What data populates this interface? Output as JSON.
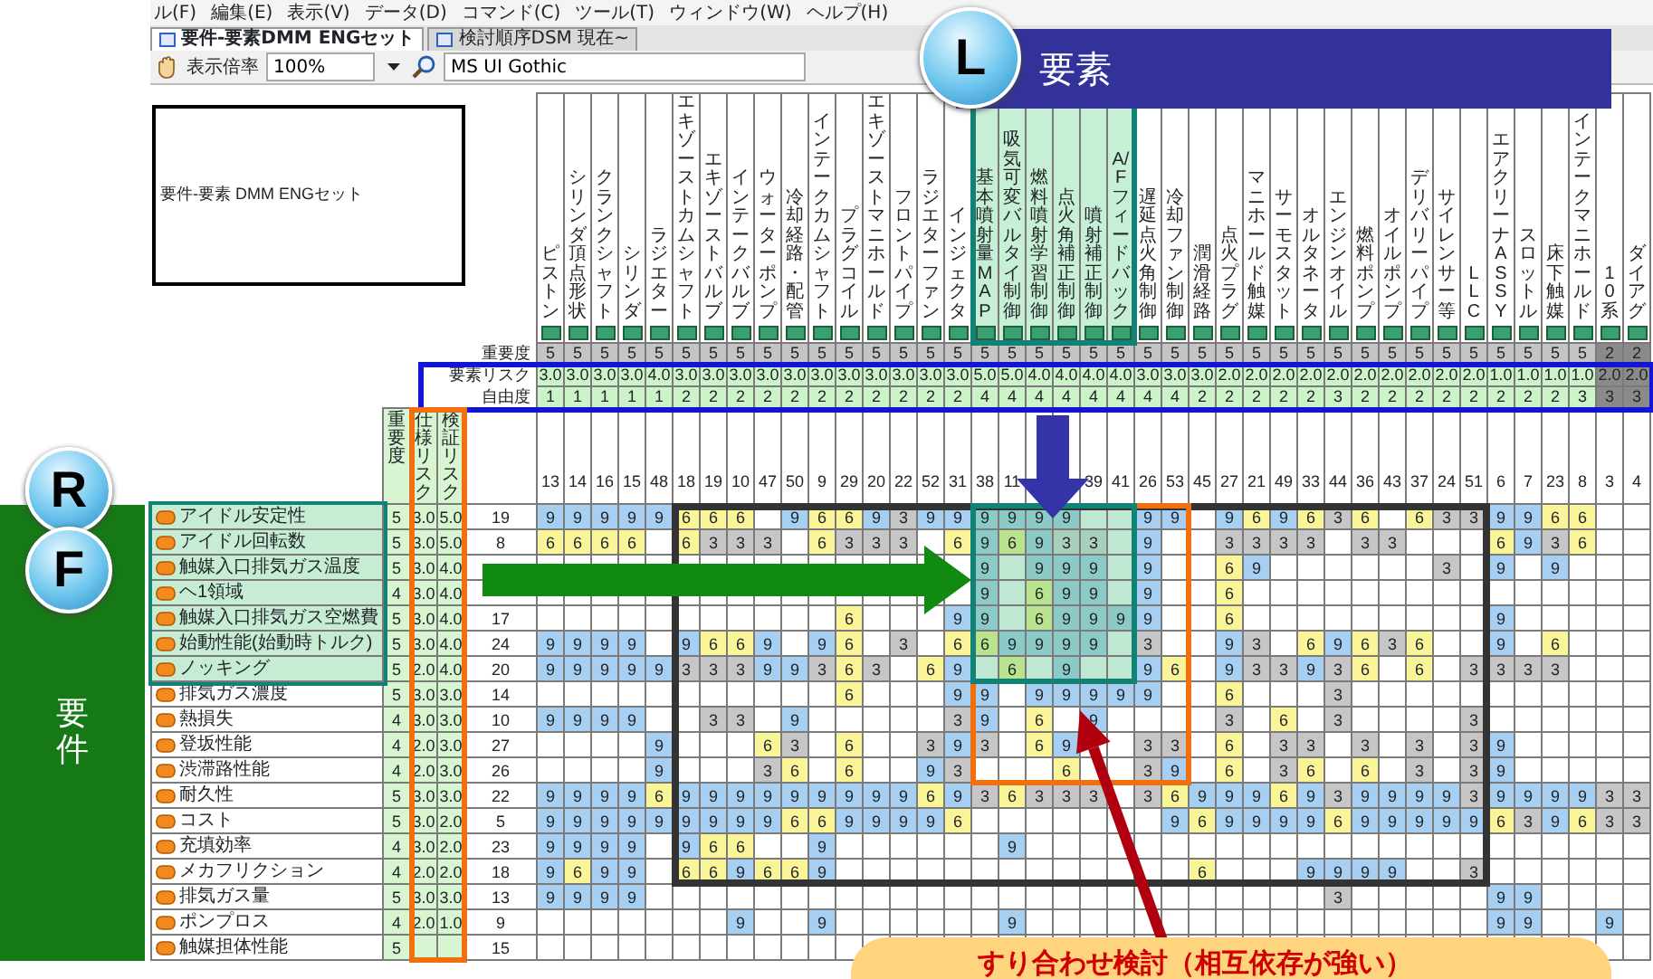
{
  "menu_bar": [
    "ル(F)",
    "編集(E)",
    "表示(V)",
    "データ(D)",
    "コマンド(C)",
    "ツール(T)",
    "ウィンドウ(W)",
    "ヘルプ(H)"
  ],
  "tabs": [
    {
      "label": "要件-要素DMM ENGセット",
      "selected": true
    },
    {
      "label": "検討順序DSM 現在~",
      "selected": false
    }
  ],
  "toolbar": {
    "zoom_label": "表示倍率",
    "zoom_value": "100%",
    "font_value": "MS UI Gothic"
  },
  "matrix": {
    "title": "要件-要素 DMM ENGセット",
    "header_labels": [
      "重要度",
      "要素リスク",
      "自由度"
    ],
    "row_header_labels": [
      "重要度",
      "仕様リスク",
      "検証リスク"
    ],
    "columns": [
      {
        "name": "ピストン",
        "importance": "5",
        "risk": "3.0",
        "freedom": "1",
        "number": "13",
        "grayed": false,
        "focus_frame": false
      },
      {
        "name": "シリンダ頂点形状",
        "importance": "5",
        "risk": "3.0",
        "freedom": "1",
        "number": "14",
        "grayed": false,
        "focus_frame": false
      },
      {
        "name": "クランクシャフト",
        "importance": "5",
        "risk": "3.0",
        "freedom": "1",
        "number": "16",
        "grayed": false,
        "focus_frame": false
      },
      {
        "name": "シリンダ",
        "importance": "5",
        "risk": "3.0",
        "freedom": "1",
        "number": "15",
        "grayed": false,
        "focus_frame": false
      },
      {
        "name": "ラジエター",
        "importance": "5",
        "risk": "4.0",
        "freedom": "1",
        "number": "48",
        "grayed": false,
        "focus_frame": false
      },
      {
        "name": "エキゾーストカムシャフト",
        "importance": "5",
        "risk": "3.0",
        "freedom": "2",
        "number": "18",
        "grayed": false,
        "focus_frame": false
      },
      {
        "name": "エキゾーストバルブ",
        "importance": "5",
        "risk": "3.0",
        "freedom": "2",
        "number": "19",
        "grayed": false,
        "focus_frame": false
      },
      {
        "name": "インテークバルブ",
        "importance": "5",
        "risk": "3.0",
        "freedom": "2",
        "number": "10",
        "grayed": false,
        "focus_frame": false
      },
      {
        "name": "ウォーターポンプ",
        "importance": "5",
        "risk": "3.0",
        "freedom": "2",
        "number": "47",
        "grayed": false,
        "focus_frame": false
      },
      {
        "name": "冷却経路・配管",
        "importance": "5",
        "risk": "3.0",
        "freedom": "2",
        "number": "50",
        "grayed": false,
        "focus_frame": false
      },
      {
        "name": "インテークカムシャフト",
        "importance": "5",
        "risk": "3.0",
        "freedom": "2",
        "number": "9",
        "grayed": false,
        "focus_frame": false
      },
      {
        "name": "プラグコイル",
        "importance": "5",
        "risk": "3.0",
        "freedom": "2",
        "number": "29",
        "grayed": false,
        "focus_frame": false
      },
      {
        "name": "エキゾーストマニホールド",
        "importance": "5",
        "risk": "3.0",
        "freedom": "2",
        "number": "20",
        "grayed": false,
        "focus_frame": false
      },
      {
        "name": "フロントパイプ",
        "importance": "5",
        "risk": "3.0",
        "freedom": "2",
        "number": "22",
        "grayed": false,
        "focus_frame": false
      },
      {
        "name": "ラジエターファン",
        "importance": "5",
        "risk": "3.0",
        "freedom": "2",
        "number": "52",
        "grayed": false,
        "focus_frame": false
      },
      {
        "name": "インジェクタ",
        "importance": "5",
        "risk": "3.0",
        "freedom": "2",
        "number": "31",
        "grayed": false,
        "focus_frame": false
      },
      {
        "name": "基本噴射量MAP",
        "importance": "5",
        "risk": "5.0",
        "freedom": "4",
        "number": "38",
        "grayed": false,
        "focus_frame": true
      },
      {
        "name": "吸気可変バルタイ制御",
        "importance": "5",
        "risk": "5.0",
        "freedom": "4",
        "number": "11",
        "grayed": false,
        "focus_frame": true
      },
      {
        "name": "燃料噴射学習制御",
        "importance": "5",
        "risk": "4.0",
        "freedom": "4",
        "grayed": false,
        "focus_frame": true
      },
      {
        "name": "点火角補正制御",
        "importance": "5",
        "risk": "4.0",
        "freedom": "4",
        "grayed": false,
        "focus_frame": true
      },
      {
        "name": "噴射補正制御",
        "importance": "5",
        "risk": "4.0",
        "freedom": "4",
        "number": "39",
        "grayed": false,
        "focus_frame": true
      },
      {
        "name": "A/Fフィードバック",
        "importance": "5",
        "risk": "4.0",
        "freedom": "4",
        "number": "41",
        "grayed": false,
        "focus_frame": true
      },
      {
        "name": "遅延点火角制御",
        "importance": "5",
        "risk": "3.0",
        "freedom": "4",
        "number": "26",
        "grayed": false,
        "focus_frame": false
      },
      {
        "name": "冷却ファン制御",
        "importance": "5",
        "risk": "3.0",
        "freedom": "4",
        "number": "53",
        "grayed": false,
        "focus_frame": false
      },
      {
        "name": "潤滑経路",
        "importance": "5",
        "risk": "3.0",
        "freedom": "2",
        "number": "45",
        "grayed": false,
        "focus_frame": false
      },
      {
        "name": "点火プラグ",
        "importance": "5",
        "risk": "2.0",
        "freedom": "2",
        "number": "27",
        "grayed": false,
        "focus_frame": false
      },
      {
        "name": "マニホールド触媒",
        "importance": "5",
        "risk": "2.0",
        "freedom": "2",
        "number": "21",
        "grayed": false,
        "focus_frame": false
      },
      {
        "name": "サーモスタット",
        "importance": "5",
        "risk": "2.0",
        "freedom": "2",
        "number": "49",
        "grayed": false,
        "focus_frame": false
      },
      {
        "name": "オルタネータ",
        "importance": "5",
        "risk": "2.0",
        "freedom": "2",
        "number": "33",
        "grayed": false,
        "focus_frame": false
      },
      {
        "name": "エンジンオイル",
        "importance": "5",
        "risk": "2.0",
        "freedom": "3",
        "number": "44",
        "grayed": false,
        "focus_frame": false
      },
      {
        "name": "燃料ポンプ",
        "importance": "5",
        "risk": "2.0",
        "freedom": "2",
        "number": "36",
        "grayed": false,
        "focus_frame": false
      },
      {
        "name": "オイルポンプ",
        "importance": "5",
        "risk": "2.0",
        "freedom": "2",
        "number": "43",
        "grayed": false,
        "focus_frame": false
      },
      {
        "name": "デリバリーパイプ",
        "importance": "5",
        "risk": "2.0",
        "freedom": "2",
        "number": "37",
        "grayed": false,
        "focus_frame": false
      },
      {
        "name": "サイレンサー等",
        "importance": "5",
        "risk": "2.0",
        "freedom": "2",
        "number": "24",
        "grayed": false,
        "focus_frame": false
      },
      {
        "name": "LLC",
        "importance": "5",
        "risk": "2.0",
        "freedom": "2",
        "number": "51",
        "grayed": false,
        "focus_frame": false
      },
      {
        "name": "エアクリーナASSY",
        "importance": "5",
        "risk": "1.0",
        "freedom": "2",
        "number": "6",
        "grayed": false,
        "focus_frame": false
      },
      {
        "name": "スロットル",
        "importance": "5",
        "risk": "1.0",
        "freedom": "2",
        "number": "7",
        "grayed": false,
        "focus_frame": false
      },
      {
        "name": "床下触媒",
        "importance": "5",
        "risk": "1.0",
        "freedom": "2",
        "number": "23",
        "grayed": false,
        "focus_frame": false
      },
      {
        "name": "インテークマニホールド",
        "importance": "5",
        "risk": "1.0",
        "freedom": "3",
        "number": "8",
        "grayed": false,
        "focus_frame": false
      },
      {
        "name": "10系",
        "importance": "2",
        "risk": "2.0",
        "freedom": "3",
        "number": "3",
        "grayed": true,
        "focus_frame": false
      },
      {
        "name": "ダイアグ",
        "importance": "2",
        "risk": "2.0",
        "freedom": "3",
        "number": "4",
        "grayed": true,
        "focus_frame": false
      }
    ],
    "rows": [
      {
        "label": "アイドル安定性",
        "importance": "5",
        "spec_risk": "3.0",
        "verify_risk": "5.0",
        "number": "19",
        "focus_frame": true,
        "cells": [
          "9",
          "9",
          "9",
          "9",
          "9",
          "6",
          "6",
          "6",
          null,
          "9",
          "6",
          "6",
          "9",
          "3",
          "9",
          "9",
          "9",
          "9",
          "9",
          "9",
          null,
          null,
          "9",
          "9",
          null,
          "9",
          "6",
          "9",
          "6",
          "3",
          "6",
          null,
          "6",
          "3",
          "3",
          "9",
          "9",
          "6",
          "6",
          null,
          null
        ]
      },
      {
        "label": "アイドル回転数",
        "importance": "5",
        "spec_risk": "3.0",
        "verify_risk": "5.0",
        "number": "8",
        "focus_frame": true,
        "cells": [
          "6",
          "6",
          "6",
          "6",
          null,
          "6",
          "3",
          "3",
          "3",
          null,
          "6",
          "3",
          "3",
          "3",
          null,
          "6",
          "9",
          "6",
          "9",
          "3",
          "3",
          null,
          "9",
          null,
          null,
          "3",
          "3",
          "3",
          "3",
          null,
          "3",
          "3",
          null,
          null,
          null,
          "6",
          "9",
          "3",
          "6",
          null,
          null
        ]
      },
      {
        "label": "触媒入口排気ガス温度",
        "importance": "5",
        "spec_risk": "3.0",
        "verify_risk": "4.0",
        "focus_frame": true,
        "cells": [
          null,
          null,
          null,
          null,
          null,
          null,
          null,
          null,
          null,
          null,
          null,
          null,
          null,
          null,
          null,
          null,
          "9",
          null,
          "9",
          "9",
          "9",
          null,
          "9",
          null,
          null,
          "6",
          "9",
          null,
          null,
          null,
          null,
          null,
          null,
          "3",
          null,
          "9",
          null,
          "9",
          null,
          null,
          null
        ]
      },
      {
        "label": "ヘ1領域",
        "importance": "4",
        "spec_risk": "3.0",
        "verify_risk": "4.0",
        "focus_frame": true,
        "cells": [
          null,
          null,
          null,
          null,
          null,
          null,
          null,
          null,
          null,
          null,
          null,
          null,
          null,
          null,
          null,
          null,
          "9",
          null,
          "6",
          "9",
          "9",
          null,
          "9",
          null,
          null,
          "6",
          null,
          null,
          null,
          null,
          null,
          null,
          null,
          null,
          null,
          null,
          null,
          null,
          null,
          null,
          null
        ]
      },
      {
        "label": "触媒入口排気ガス空燃費",
        "importance": "5",
        "spec_risk": "3.0",
        "verify_risk": "4.0",
        "number": "17",
        "focus_frame": true,
        "cells": [
          null,
          null,
          null,
          null,
          null,
          null,
          null,
          null,
          null,
          null,
          null,
          "6",
          null,
          null,
          null,
          "9",
          "9",
          null,
          "6",
          "9",
          "9",
          "9",
          "9",
          null,
          null,
          "6",
          null,
          null,
          null,
          null,
          null,
          null,
          null,
          null,
          null,
          "9",
          null,
          null,
          null,
          null,
          null
        ]
      },
      {
        "label": "始動性能(始動時トルク)",
        "importance": "5",
        "spec_risk": "3.0",
        "verify_risk": "4.0",
        "number": "24",
        "focus_frame": true,
        "cells": [
          "9",
          "9",
          "9",
          "9",
          null,
          "9",
          "6",
          "6",
          "9",
          null,
          "9",
          "6",
          null,
          "3",
          null,
          "6",
          "6",
          "9",
          "9",
          "9",
          "9",
          null,
          "3",
          null,
          null,
          "9",
          "3",
          null,
          "6",
          "9",
          "6",
          "3",
          "6",
          null,
          null,
          "9",
          null,
          "6",
          null,
          null,
          null
        ]
      },
      {
        "label": "ノッキング",
        "importance": "5",
        "spec_risk": "2.0",
        "verify_risk": "4.0",
        "number": "20",
        "focus_frame": true,
        "cells": [
          "9",
          "9",
          "9",
          "9",
          "9",
          "3",
          "3",
          "3",
          "9",
          "9",
          "3",
          "6",
          "3",
          null,
          "6",
          "9",
          null,
          "6",
          null,
          "9",
          null,
          null,
          "9",
          "6",
          null,
          "9",
          "3",
          "3",
          "9",
          "3",
          "6",
          null,
          "6",
          null,
          "3",
          "3",
          "3",
          "3",
          null,
          null,
          null
        ]
      },
      {
        "label": "排気ガス濃度",
        "importance": "5",
        "spec_risk": "3.0",
        "verify_risk": "3.0",
        "number": "14",
        "focus_frame": false,
        "cells": [
          null,
          null,
          null,
          null,
          null,
          null,
          null,
          null,
          null,
          null,
          null,
          "6",
          null,
          null,
          null,
          "9",
          "9",
          null,
          "9",
          "9",
          "9",
          "9",
          "9",
          null,
          null,
          "6",
          null,
          null,
          null,
          "3",
          null,
          null,
          null,
          null,
          null,
          null,
          null,
          null,
          null,
          null,
          null
        ]
      },
      {
        "label": "熱損失",
        "importance": "4",
        "spec_risk": "3.0",
        "verify_risk": "3.0",
        "number": "10",
        "focus_frame": false,
        "cells": [
          "9",
          "9",
          "9",
          "9",
          null,
          null,
          "3",
          "3",
          null,
          "9",
          null,
          null,
          null,
          null,
          null,
          "3",
          "9",
          null,
          "6",
          null,
          "9",
          null,
          null,
          null,
          null,
          "3",
          null,
          "6",
          null,
          "3",
          null,
          null,
          null,
          null,
          "3",
          null,
          null,
          null,
          null,
          null,
          null
        ]
      },
      {
        "label": "登坂性能",
        "importance": "4",
        "spec_risk": "2.0",
        "verify_risk": "3.0",
        "number": "27",
        "focus_frame": false,
        "cells": [
          null,
          null,
          null,
          null,
          "9",
          null,
          null,
          null,
          "6",
          "3",
          null,
          "6",
          null,
          null,
          "3",
          "9",
          "3",
          null,
          "6",
          "9",
          null,
          null,
          "3",
          "3",
          null,
          "6",
          null,
          "3",
          "3",
          null,
          "3",
          null,
          "3",
          null,
          "3",
          "9",
          null,
          null,
          null,
          null,
          null
        ]
      },
      {
        "label": "渋滞路性能",
        "importance": "4",
        "spec_risk": "2.0",
        "verify_risk": "3.0",
        "number": "26",
        "focus_frame": false,
        "cells": [
          null,
          null,
          null,
          null,
          "9",
          null,
          null,
          null,
          "3",
          "6",
          null,
          "6",
          null,
          null,
          "9",
          "3",
          null,
          null,
          null,
          "6",
          null,
          null,
          "3",
          "9",
          null,
          "6",
          null,
          "3",
          "6",
          null,
          "6",
          null,
          "3",
          null,
          "3",
          "9",
          null,
          null,
          null,
          null,
          null
        ]
      },
      {
        "label": "耐久性",
        "importance": "5",
        "spec_risk": "3.0",
        "verify_risk": "3.0",
        "number": "22",
        "focus_frame": false,
        "cells": [
          "9",
          "9",
          "9",
          "9",
          "6",
          "9",
          "9",
          "9",
          "9",
          "9",
          "9",
          "9",
          "9",
          "9",
          "6",
          "9",
          "3",
          "6",
          "3",
          "3",
          "3",
          null,
          "3",
          "6",
          "9",
          "9",
          "9",
          "6",
          "9",
          "3",
          "9",
          "9",
          "9",
          "9",
          "3",
          "9",
          "9",
          "9",
          "9",
          "3",
          "3"
        ]
      },
      {
        "label": "コスト",
        "importance": "5",
        "spec_risk": "3.0",
        "verify_risk": "2.0",
        "number": "5",
        "focus_frame": false,
        "cells": [
          "9",
          "9",
          "9",
          "9",
          "9",
          "9",
          "9",
          "9",
          "9",
          "6",
          "6",
          "9",
          "9",
          "9",
          "9",
          "6",
          null,
          null,
          null,
          null,
          null,
          null,
          null,
          "9",
          "6",
          "9",
          "9",
          "9",
          "9",
          "6",
          "9",
          "9",
          "9",
          "9",
          "9",
          "6",
          "3",
          "9",
          "6",
          "3",
          "3"
        ]
      },
      {
        "label": "充填効率",
        "importance": "4",
        "spec_risk": "3.0",
        "verify_risk": "2.0",
        "number": "23",
        "focus_frame": false,
        "cells": [
          "9",
          "9",
          "9",
          "9",
          null,
          "9",
          "6",
          "6",
          null,
          null,
          "9",
          null,
          null,
          null,
          null,
          null,
          null,
          "9",
          null,
          null,
          null,
          null,
          null,
          null,
          null,
          null,
          null,
          null,
          null,
          null,
          null,
          null,
          null,
          null,
          null,
          null,
          null,
          null,
          null,
          null,
          null
        ]
      },
      {
        "label": "メカフリクション",
        "importance": "4",
        "spec_risk": "2.0",
        "verify_risk": "2.0",
        "number": "18",
        "focus_frame": false,
        "cells": [
          "9",
          "6",
          "9",
          "9",
          null,
          "6",
          "6",
          "9",
          "6",
          "6",
          "9",
          null,
          null,
          null,
          null,
          null,
          null,
          null,
          null,
          null,
          null,
          null,
          null,
          null,
          "6",
          null,
          null,
          null,
          "9",
          "9",
          "9",
          "9",
          null,
          null,
          "3",
          null,
          null,
          null,
          null,
          null,
          null
        ]
      },
      {
        "label": "排気ガス量",
        "importance": "5",
        "spec_risk": "3.0",
        "verify_risk": "3.0",
        "number": "13",
        "focus_frame": false,
        "cells": [
          "9",
          "9",
          "9",
          "9",
          null,
          null,
          null,
          null,
          null,
          null,
          null,
          null,
          null,
          null,
          null,
          null,
          null,
          null,
          null,
          null,
          null,
          null,
          null,
          null,
          null,
          null,
          null,
          null,
          null,
          "3",
          null,
          null,
          null,
          null,
          null,
          "9",
          "9",
          null,
          null,
          null,
          null
        ]
      },
      {
        "label": "ポンプロス",
        "importance": "4",
        "spec_risk": "2.0",
        "verify_risk": "1.0",
        "number": "9",
        "focus_frame": false,
        "cells": [
          null,
          null,
          null,
          null,
          null,
          null,
          null,
          "9",
          null,
          null,
          "9",
          null,
          null,
          null,
          null,
          null,
          null,
          "9",
          null,
          null,
          null,
          null,
          null,
          null,
          null,
          null,
          null,
          null,
          null,
          null,
          null,
          null,
          null,
          null,
          null,
          "9",
          "9",
          null,
          null,
          "9",
          null
        ]
      },
      {
        "label": "触媒担体性能",
        "importance": "5",
        "number": "15",
        "focus_frame": false
      }
    ]
  },
  "annotations": {
    "element_badge": "L",
    "element_banner": "要素",
    "requirement_badges": [
      "R",
      "F"
    ],
    "requirement_band": "要件",
    "callout": "すり合わせ検討（相互依存が強い）"
  }
}
